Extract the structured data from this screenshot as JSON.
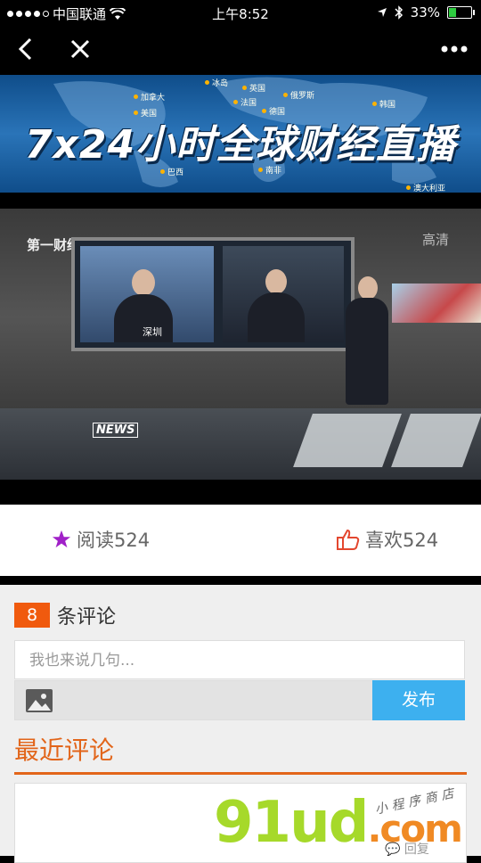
{
  "status_bar": {
    "carrier": "中国联通",
    "time": "上午8:52",
    "battery": "33%"
  },
  "banner": {
    "title": "7x24小时全球财经直播",
    "cities": [
      "加拿大",
      "美国",
      "法国",
      "英国",
      "俄罗斯",
      "韩国",
      "德国",
      "巴西",
      "南非",
      "澳大利亚",
      "冰岛"
    ]
  },
  "video": {
    "channel_logo": "第一财经",
    "quality": "高清",
    "news_logo": "NEWS",
    "location_tag": "深圳"
  },
  "stats": {
    "read_label": "阅读524",
    "like_label": "喜欢524",
    "read_icon_color": "#a020c8",
    "like_icon_color": "#e3472f"
  },
  "comments": {
    "count": "8",
    "count_suffix": "条评论",
    "placeholder": "我也来说几句...",
    "publish_label": "发布",
    "recent_title": "最近评论",
    "accent_color": "#e2651a",
    "publish_color": "#3db0ef"
  },
  "watermark": {
    "main": "91ud",
    "domain": ".com",
    "sub": "小程序商店"
  },
  "reply_partial": "回复"
}
